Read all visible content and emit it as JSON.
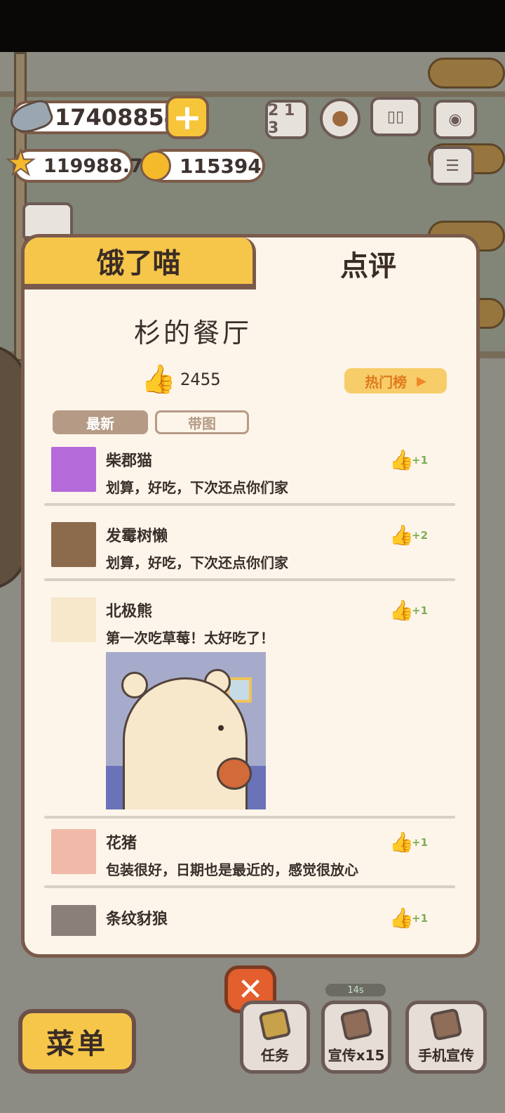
{
  "currencies": {
    "fish": "17408854",
    "stars": "119988.7",
    "bells": "115394"
  },
  "hud_icons": [
    "ranking-icon",
    "settings-gear-icon",
    "recipe-book-icon",
    "camera-icon",
    "notes-icon"
  ],
  "tabs": {
    "left": "饿了喵",
    "right": "点评",
    "active": "right"
  },
  "restaurant": {
    "name": "杉的餐厅",
    "likes": "2455",
    "hot_list_label": "热门榜"
  },
  "filters": {
    "latest": "最新",
    "with_image": "带图",
    "active": "latest"
  },
  "reviews": [
    {
      "name": "柴郡猫",
      "text": "划算，好吃，下次还点你们家",
      "likes": "+1",
      "avatar_color": "#b46ad9"
    },
    {
      "name": "发霉树懒",
      "text": "划算，好吃，下次还点你们家",
      "likes": "+2",
      "avatar_color": "#8c6a4c"
    },
    {
      "name": "北极熊",
      "text": "第一次吃草莓！太好吃了！",
      "likes": "+1",
      "avatar_color": "#f7e7cb",
      "has_image": true
    },
    {
      "name": "花猪",
      "text": "包装很好，日期也是最近的，感觉很放心",
      "likes": "+1",
      "avatar_color": "#f1b9a8"
    },
    {
      "name": "条纹豺狼",
      "text": "",
      "likes": "+1",
      "avatar_color": "#8b8079"
    }
  ],
  "bottom": {
    "menu": "菜单",
    "tasks": "任务",
    "promote": "宣传x15",
    "phone_promote": "手机宣传",
    "timer": "14s"
  },
  "colors": {
    "panel_bg": "#fdf5ea",
    "tab_active": "#f6c64a",
    "border": "#7a5b4b",
    "like_green": "#7fae54",
    "like_orange": "#e39551",
    "close_red": "#e35f2d"
  }
}
